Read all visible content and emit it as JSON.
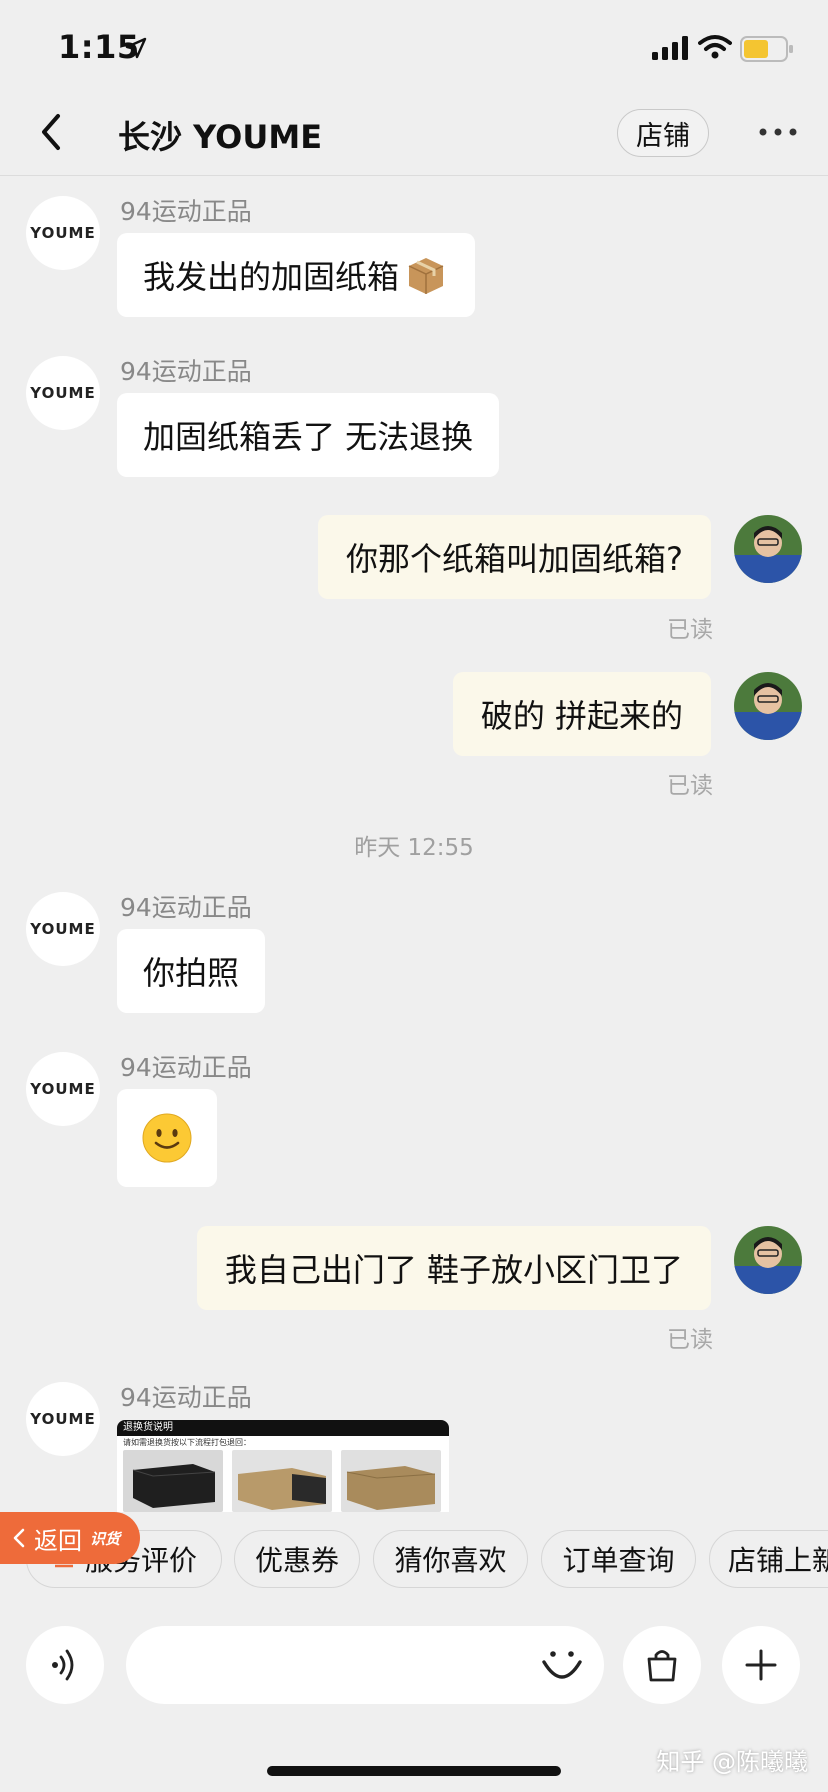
{
  "status": {
    "time": "1:15"
  },
  "header": {
    "title": "长沙 YOUME",
    "store_label": "店铺"
  },
  "shop_avatar_text": "YOUME",
  "messages": [
    {
      "sender": "94运动正品",
      "text": "我发出的加固纸箱"
    },
    {
      "sender": "94运动正品",
      "text": "加固纸箱丢了 无法退换"
    },
    {
      "text": "你那个纸箱叫加固纸箱?",
      "status": "已读"
    },
    {
      "text": "破的 拼起来的",
      "status": "已读"
    },
    {
      "divider": "昨天 12:55"
    },
    {
      "sender": "94运动正品",
      "text": "你拍照"
    },
    {
      "sender": "94运动正品",
      "icon": "smile-emoji"
    },
    {
      "text": "我自己出门了 鞋子放小区门卫了",
      "status": "已读"
    },
    {
      "sender": "94运动正品",
      "image_title": "退换货说明",
      "image_subtitle": "请如需退换货按以下流程打包退回："
    }
  ],
  "return_float": {
    "label": "返回",
    "badge": "识货"
  },
  "quick_bar": [
    "服务评价",
    "优惠券",
    "猜你喜欢",
    "订单查询",
    "店铺上新"
  ],
  "input": {
    "placeholder": ""
  },
  "watermark": "知乎 @陈曦曦"
}
